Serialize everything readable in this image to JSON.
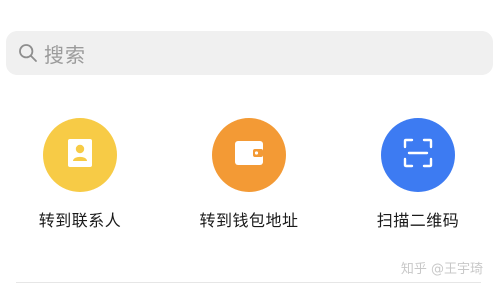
{
  "search": {
    "placeholder": "搜索",
    "icon": "search-icon"
  },
  "actions": [
    {
      "label": "转到联系人",
      "icon": "contact-card-icon",
      "color": "#F7CB46"
    },
    {
      "label": "转到钱包地址",
      "icon": "wallet-icon",
      "color": "#F39A35"
    },
    {
      "label": "扫描二维码",
      "icon": "scan-qr-icon",
      "color": "#3D7BF2"
    }
  ],
  "watermark": {
    "text": "知乎 @王宇琦"
  }
}
